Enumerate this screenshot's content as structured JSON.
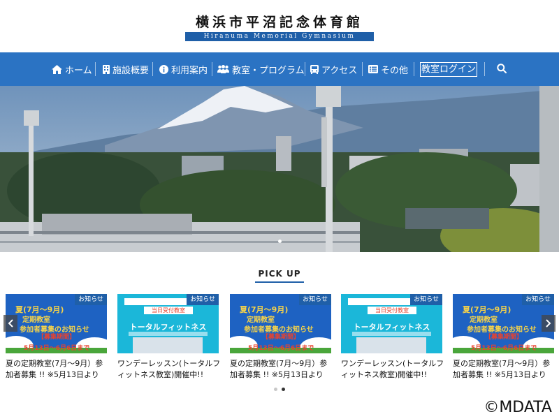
{
  "site": {
    "title_jp": "横浜市平沼記念体育館",
    "title_en": "Hiranuma Memorial Gymnasium"
  },
  "nav": {
    "items": [
      {
        "label": "ホーム",
        "icon": "home-icon"
      },
      {
        "label": "施設概要",
        "icon": "building-icon"
      },
      {
        "label": "利用案内",
        "icon": "info-icon"
      },
      {
        "label": "教室・プログラム",
        "icon": "people-icon"
      },
      {
        "label": "アクセス",
        "icon": "bus-icon"
      },
      {
        "label": "その他",
        "icon": "list-icon"
      }
    ],
    "login_label": "教室ログイン",
    "search_icon": "search-icon",
    "bar_color": "#2b73c3"
  },
  "pickup": {
    "heading": "PICK UP",
    "accent_color": "#1f5fa8",
    "cards": [
      {
        "badge": "お知らせ",
        "title": "夏の定期教室(7月～9月）参加者募集 !! ※5月13日より",
        "img": {
          "l1": "夏(7月～9月)",
          "l2": "定期教室",
          "l3": "参加者募集のお知らせ",
          "l4": "【募集期間】",
          "l5": "5月13日～6月6日まで"
        }
      },
      {
        "badge": "お知らせ",
        "title": "ワンデーレッスン(トータルフィットネス教室)開催中!!",
        "img": {
          "tag": "当日受付教室",
          "tag2": "トータルフィットネス",
          "big": "トータルフィットネス"
        }
      },
      {
        "badge": "お知らせ",
        "title": "夏の定期教室(7月～9月）参加者募集 !! ※5月13日より",
        "img": {
          "l1": "夏(7月～9月)",
          "l2": "定期教室",
          "l3": "参加者募集のお知らせ",
          "l4": "【募集期間】",
          "l5": "5月13日～6月6日まで"
        }
      },
      {
        "badge": "お知らせ",
        "title": "ワンデーレッスン(トータルフィットネス教室)開催中!!",
        "img": {
          "tag": "当日受付教室",
          "tag2": "トータルフィットネス",
          "big": "トータルフィットネス"
        }
      },
      {
        "badge": "お知らせ",
        "title": "夏の定期教室(7月～9月）参加者募集 !! ※5月13日より",
        "img": {
          "l1": "夏(7月～9月)",
          "l2": "定期教室",
          "l3": "参加者募集のお知らせ",
          "l4": "【募集期間】",
          "l5": "5月13日～6月6日まで"
        }
      }
    ],
    "prev_icon": "chevron-left-icon",
    "next_icon": "chevron-right-icon",
    "active_dot": 2
  },
  "copyright": "©MDATA"
}
